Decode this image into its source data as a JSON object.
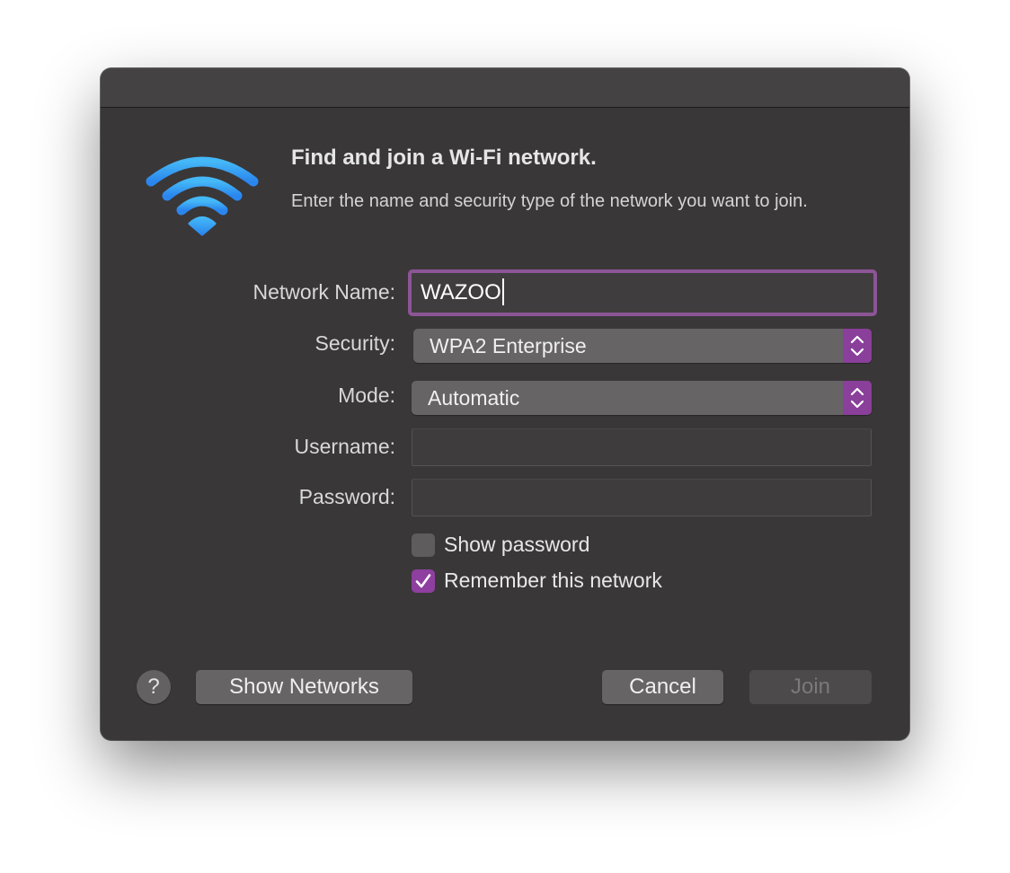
{
  "dialog": {
    "heading": "Find and join a Wi-Fi network.",
    "description": "Enter the name and security type of the network you want to join."
  },
  "form": {
    "network_name_label": "Network Name:",
    "network_name_value": "WAZOO",
    "security_label": "Security:",
    "security_value": "WPA2 Enterprise",
    "mode_label": "Mode:",
    "mode_value": "Automatic",
    "username_label": "Username:",
    "username_value": "",
    "password_label": "Password:",
    "password_value": ""
  },
  "options": {
    "show_password_label": "Show password",
    "show_password_checked": false,
    "remember_label": "Remember this network",
    "remember_checked": true
  },
  "buttons": {
    "help": "?",
    "show_networks": "Show Networks",
    "cancel": "Cancel",
    "join": "Join"
  },
  "colors": {
    "accent": "#8e3f9f",
    "wifi": "#3a9ef5",
    "dialog_bg": "#3a3738"
  },
  "icons": {
    "wifi": "wifi-icon",
    "stepper": "up-down-chevron-icon",
    "check": "checkmark-icon"
  }
}
